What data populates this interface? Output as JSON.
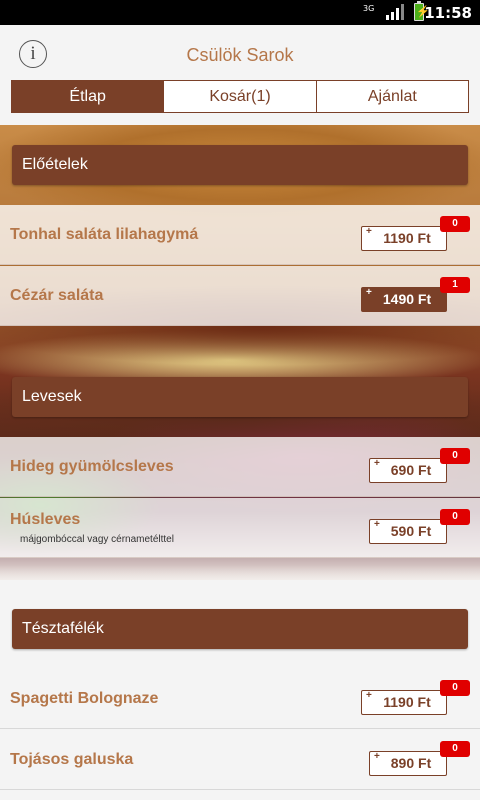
{
  "status_bar": {
    "network": "3G",
    "time": "11:58"
  },
  "header": {
    "title": "Csülök Sarok",
    "info_icon_glyph": "i"
  },
  "tabs": [
    {
      "label": "Étlap",
      "active": true
    },
    {
      "label": "Kosár(1)",
      "active": false
    },
    {
      "label": "Ajánlat",
      "active": false
    }
  ],
  "sections": [
    {
      "title": "Előételek",
      "items": [
        {
          "name": "Tonhal saláta lilahagymá",
          "description": "",
          "price": "1190 Ft",
          "count": "0"
        },
        {
          "name": "Cézár saláta",
          "description": "",
          "price": "1490 Ft",
          "count": "1"
        }
      ]
    },
    {
      "title": "Levesek",
      "items": [
        {
          "name": "Hideg gyümölcsleves",
          "description": "",
          "price": "690 Ft",
          "count": "0"
        },
        {
          "name": "Húsleves",
          "description": "májgombóccal vagy cérnametélttel",
          "price": "590 Ft",
          "count": "0"
        }
      ]
    },
    {
      "title": "Tésztafélék",
      "items": [
        {
          "name": "Spagetti Bolognaze",
          "description": "",
          "price": "1190 Ft",
          "count": "0"
        },
        {
          "name": "Tojásos galuska",
          "description": "",
          "price": "890 Ft",
          "count": "0"
        }
      ]
    }
  ],
  "price_plus_glyph": "+",
  "colors": {
    "brand_brown": "#7a4028",
    "item_text": "#b5774a",
    "badge_red": "#e00000",
    "background": "#f4f4f4"
  }
}
